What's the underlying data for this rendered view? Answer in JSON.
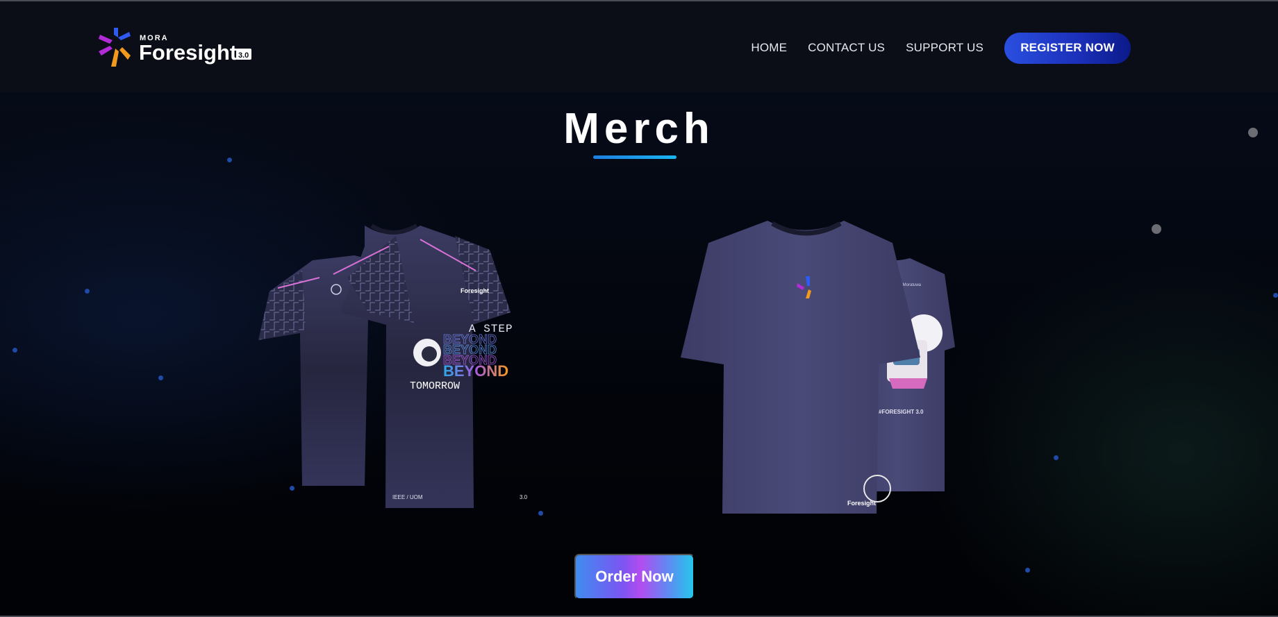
{
  "header": {
    "logo": {
      "top_text": "MORA",
      "brand": "Foresight",
      "version": "3.0"
    },
    "nav": [
      {
        "label": "HOME"
      },
      {
        "label": "CONTACT US"
      },
      {
        "label": "SUPPORT US"
      }
    ],
    "register_label": "REGISTER NOW"
  },
  "section": {
    "title": "Merch",
    "order_label": "Order Now"
  },
  "shirts": {
    "jersey": {
      "tagline_line1": "A STEP",
      "tagline_word": "BEYOND",
      "tagline_line3": "TOMORROW",
      "chest_logo": "Foresight",
      "hem_left": "IEEE / UOM",
      "hem_right": "3.0"
    },
    "tee": {
      "hem_logo": "Foresight",
      "back_text": "#FORESIGHT 3.0",
      "back_header": "University of Moratuwa"
    }
  },
  "colors": {
    "navbar_bg": "#0b0e17",
    "accent_blue": "#2a4fe0",
    "underline": "#1ab4f0",
    "shirt_navy": "#2d2d4e",
    "logo_purple": "#b12bd6",
    "logo_orange": "#f29a1c",
    "logo_blue": "#2f5bf0"
  }
}
